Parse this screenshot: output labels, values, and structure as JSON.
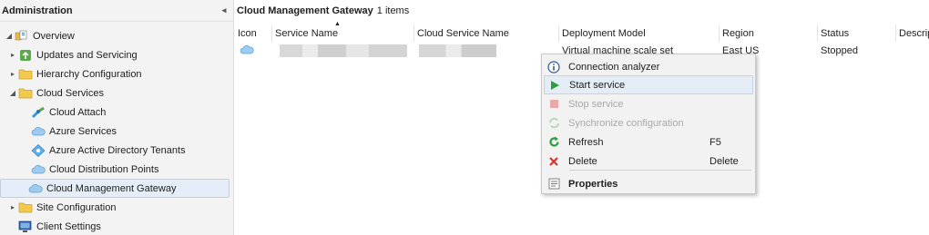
{
  "nav": {
    "title": "Administration",
    "collapse_glyph": "◂",
    "items": [
      {
        "label": "Overview",
        "icon": "overview-icon",
        "expander": "◢"
      },
      {
        "label": "Updates and Servicing",
        "icon": "updates-icon",
        "expander": "▸"
      },
      {
        "label": "Hierarchy Configuration",
        "icon": "folder-icon",
        "expander": "▸"
      },
      {
        "label": "Cloud Services",
        "icon": "folder-icon",
        "expander": "◢"
      },
      {
        "label": "Cloud Attach",
        "icon": "cloud-attach-icon"
      },
      {
        "label": "Azure Services",
        "icon": "cloud-icon"
      },
      {
        "label": "Azure Active Directory Tenants",
        "icon": "aad-icon"
      },
      {
        "label": "Cloud Distribution Points",
        "icon": "cloud-icon"
      },
      {
        "label": "Cloud Management Gateway",
        "icon": "cloud-icon",
        "selected": true
      },
      {
        "label": "Site Configuration",
        "icon": "folder-icon",
        "expander": "▸"
      },
      {
        "label": "Client Settings",
        "icon": "client-settings-icon"
      }
    ]
  },
  "main": {
    "title": "Cloud Management Gateway",
    "count": "1 items",
    "sort_glyph": "▲",
    "columns": [
      "Icon",
      "Service Name",
      "Cloud Service Name",
      "Deployment Model",
      "Region",
      "Status",
      "Descrip"
    ],
    "rows": [
      {
        "deployment_model": "Virtual machine scale set",
        "region": "East US",
        "status": "Stopped"
      }
    ]
  },
  "context_menu": {
    "items": [
      {
        "label": "Connection analyzer",
        "icon": "info-icon",
        "shortcut": ""
      },
      {
        "label": "Start service",
        "icon": "play-icon",
        "shortcut": "",
        "hover": true
      },
      {
        "label": "Stop service",
        "icon": "stop-icon",
        "shortcut": "",
        "disabled": true
      },
      {
        "label": "Synchronize configuration",
        "icon": "sync-icon",
        "shortcut": "",
        "disabled": true
      },
      {
        "label": "Refresh",
        "icon": "refresh-icon",
        "shortcut": "F5"
      },
      {
        "label": "Delete",
        "icon": "delete-icon",
        "shortcut": "Delete"
      },
      {
        "label": "Properties",
        "icon": "properties-icon",
        "shortcut": "",
        "bold": true
      }
    ]
  },
  "colors": {
    "selected_bg": "#e5eef8",
    "hover_bg": "#e4ecf6",
    "play_green": "#2e9e3e",
    "delete_red": "#d9342b",
    "folder_yellow": "#f2c94c",
    "cloud_blue": "#8fc3ea"
  }
}
